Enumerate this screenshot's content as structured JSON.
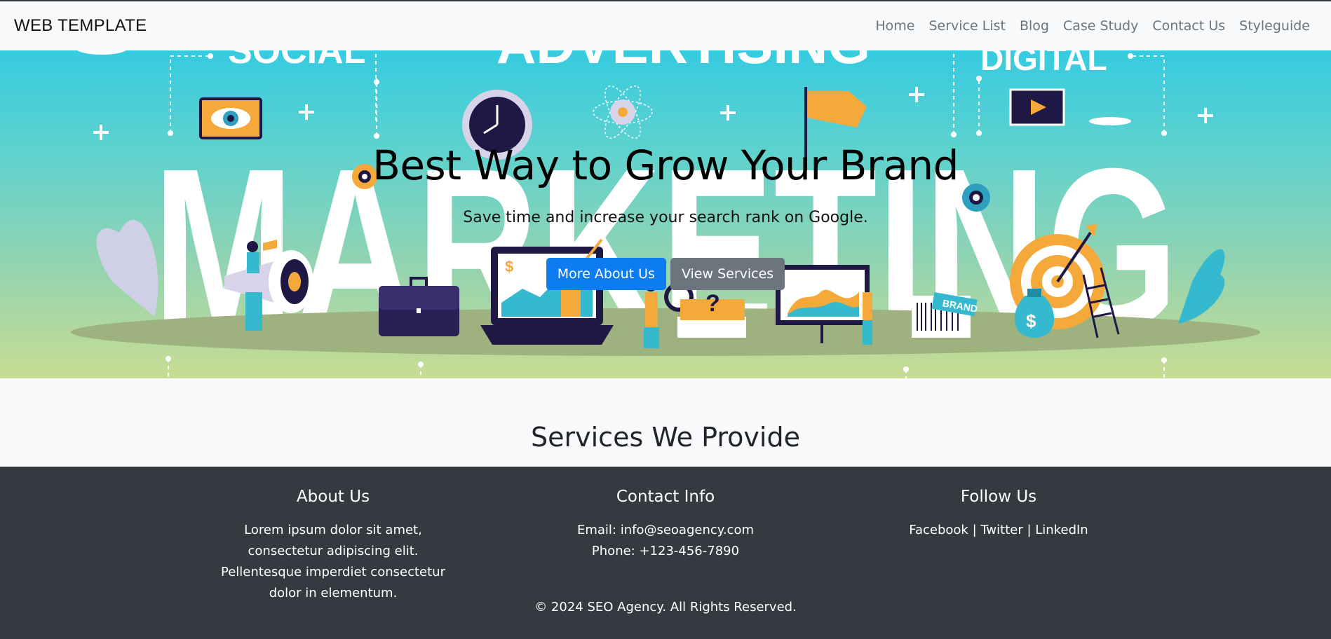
{
  "nav": {
    "brand": "WEB TEMPLATE",
    "links": [
      "Home",
      "Service List",
      "Blog",
      "Case Study",
      "Contact Us",
      "Styleguide"
    ]
  },
  "hero": {
    "art_words": {
      "social": "SOCIAL",
      "advertising": "ADVERTISING",
      "digital": "DIGITAL",
      "marketing": "MARKETING",
      "brand_tag": "BRAND"
    },
    "title": "Best Way to Grow Your Brand",
    "subtitle": "Save time and increase your search rank on Google.",
    "primary_button": "More About Us",
    "secondary_button": "View Services"
  },
  "services": {
    "heading": "Services We Provide"
  },
  "footer": {
    "about": {
      "heading": "About Us",
      "text": "Lorem ipsum dolor sit amet, consectetur adipiscing elit. Pellentesque imperdiet consectetur dolor in elementum."
    },
    "contact": {
      "heading": "Contact Info",
      "email": "Email: info@seoagency.com",
      "phone": "Phone: +123-456-7890"
    },
    "follow": {
      "heading": "Follow Us",
      "links": [
        "Facebook",
        "Twitter",
        "LinkedIn"
      ],
      "separator": "|"
    },
    "copyright": "© 2024 SEO Agency. All Rights Reserved."
  },
  "colors": {
    "primary": "#0d7cf0",
    "secondary": "#6c757d",
    "footer_bg": "#343a40",
    "hero_top": "#36cbe0",
    "hero_bottom": "#c7dc92",
    "accent_orange": "#f6a93b",
    "dark_navy": "#1f1845"
  },
  "icons": [
    "eye-icon",
    "clock-icon",
    "atom-icon",
    "flag-icon",
    "play-icon",
    "gear-icon",
    "megaphone-icon",
    "briefcase-icon",
    "laptop-icon",
    "target-icon",
    "money-bag-icon",
    "magnifier-icon",
    "chart-board-icon"
  ]
}
